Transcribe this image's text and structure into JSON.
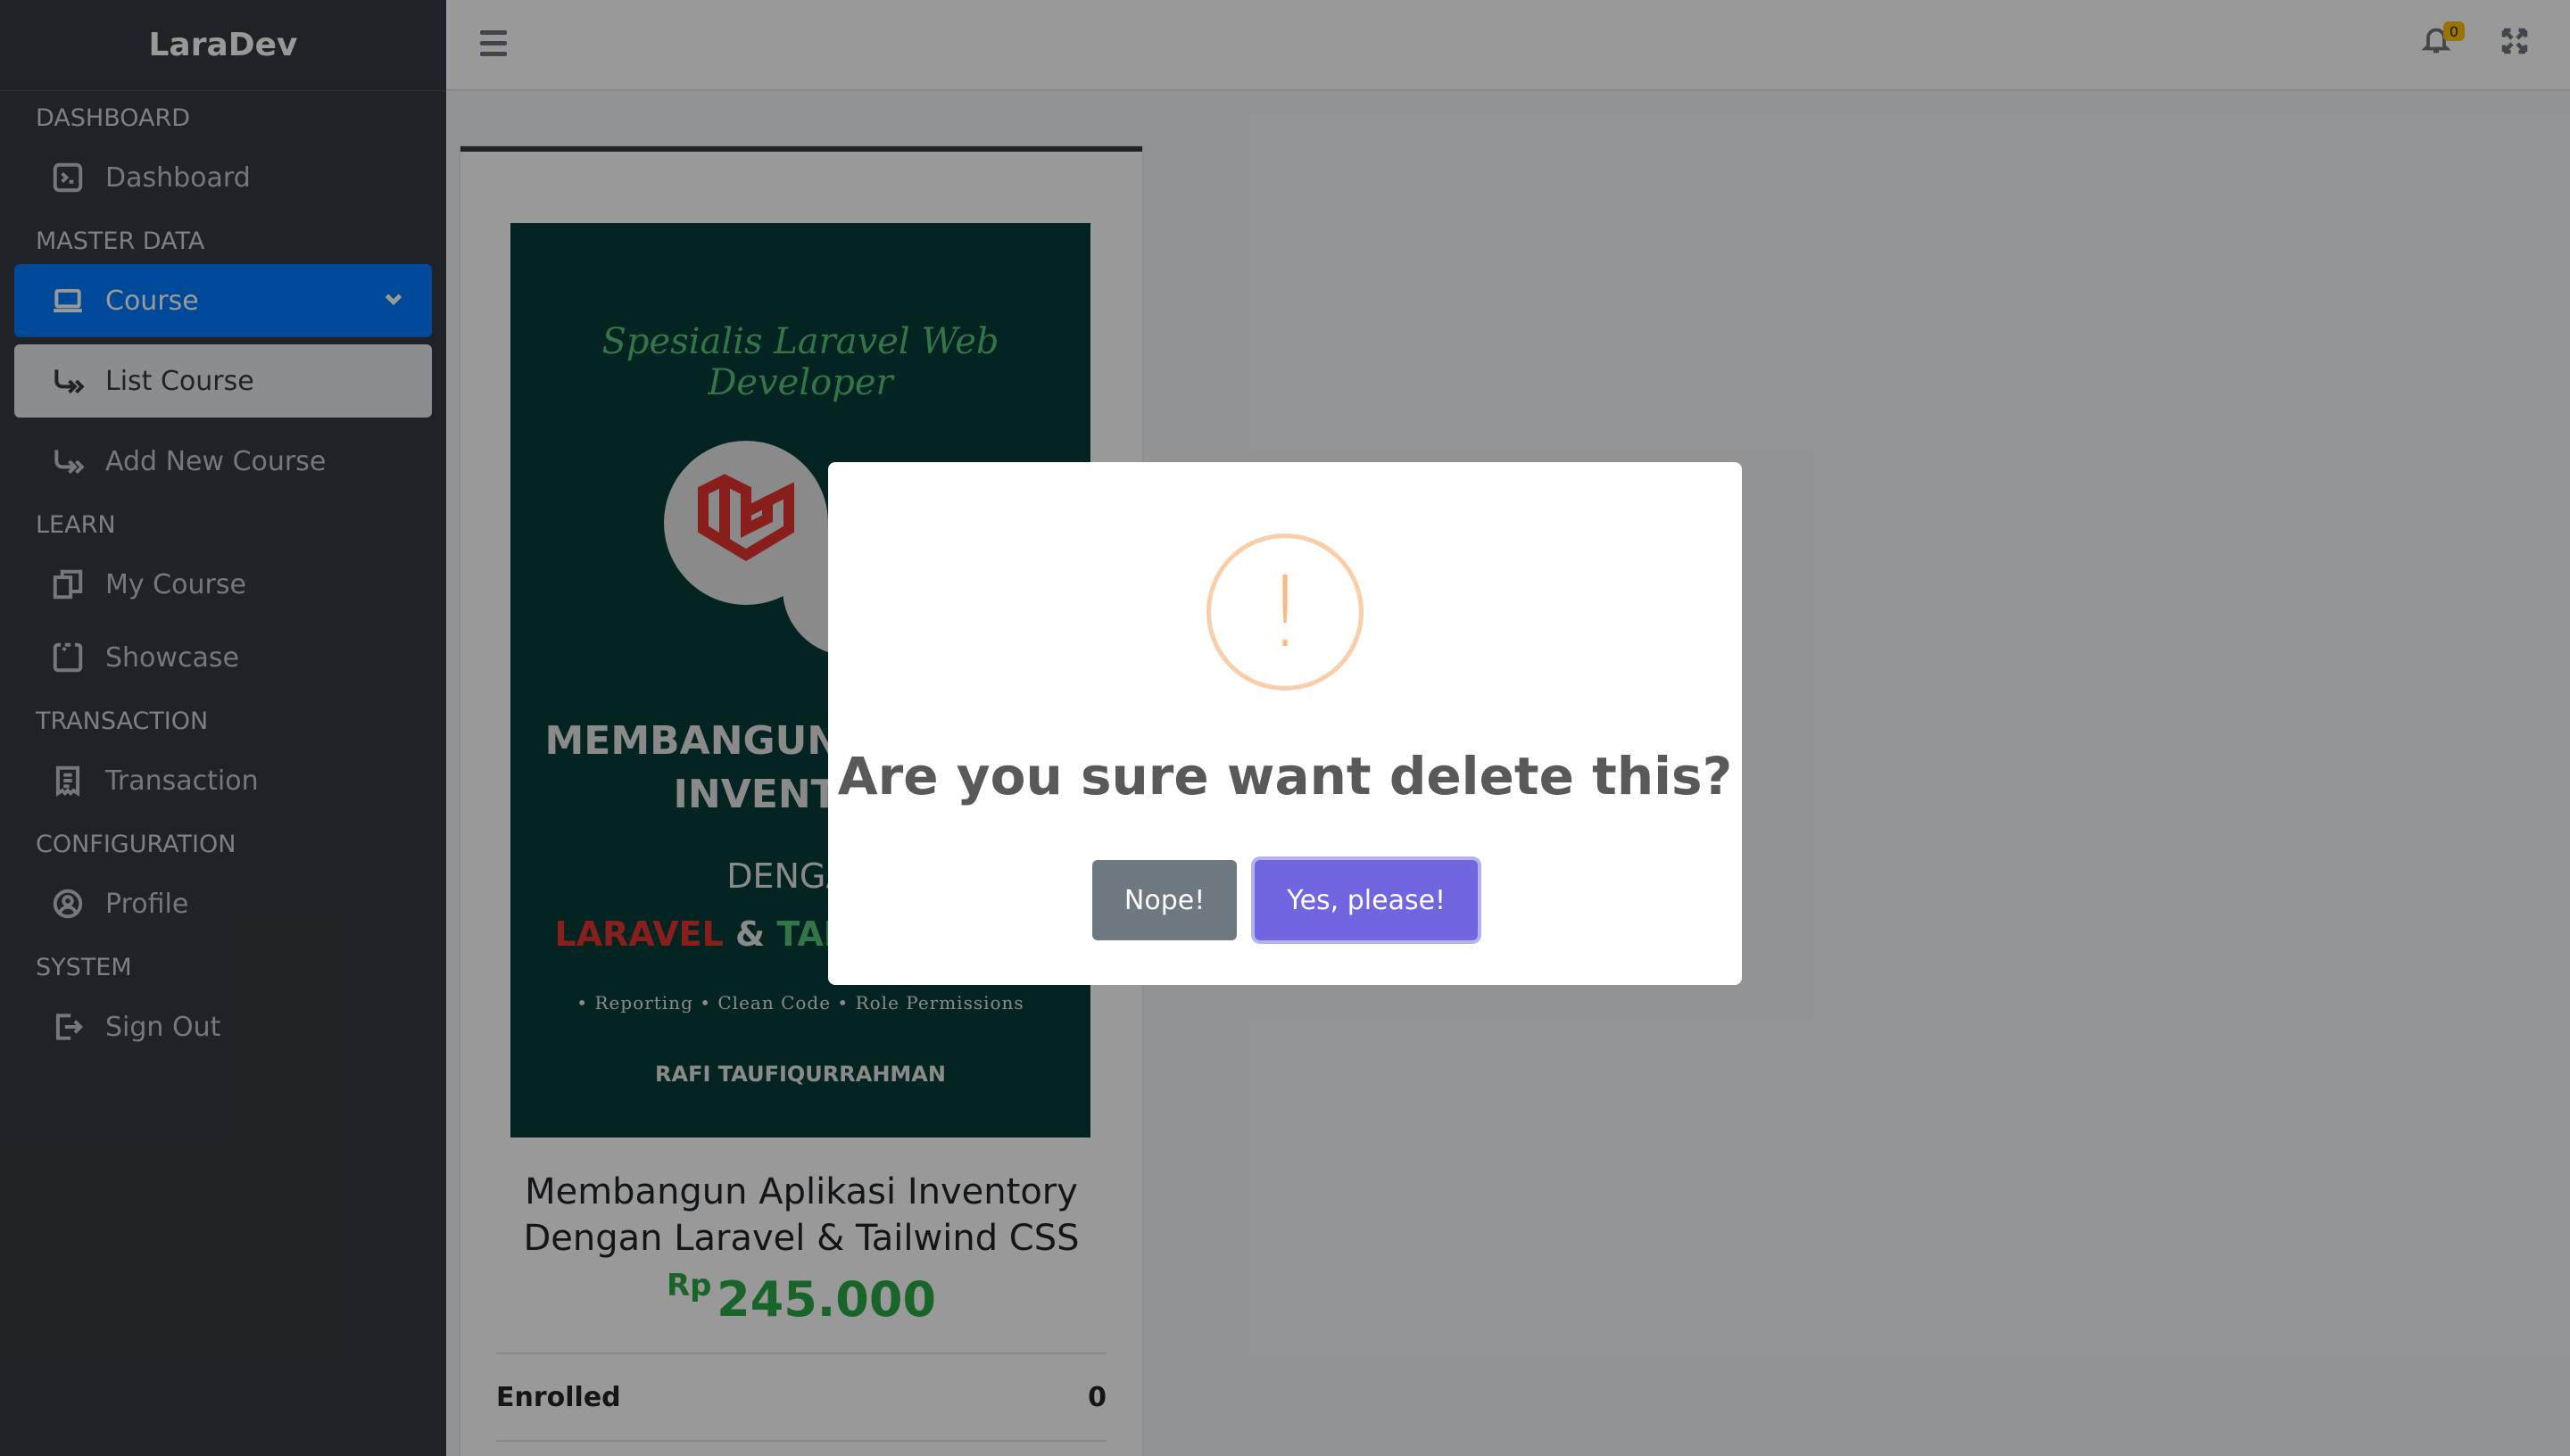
{
  "app": {
    "brand": "LaraDev"
  },
  "sidebar": {
    "sections": [
      {
        "header": "DASHBOARD",
        "items": [
          {
            "label": "Dashboard",
            "icon": "terminal-icon"
          }
        ]
      },
      {
        "header": "MASTER DATA",
        "items": [
          {
            "label": "Course",
            "icon": "laptop-icon",
            "state": "active"
          },
          {
            "label": "List Course",
            "icon": "subitem-arrow-icon",
            "state": "sub-active"
          },
          {
            "label": "Add New Course",
            "icon": "subitem-arrow-icon"
          }
        ]
      },
      {
        "header": "LEARN",
        "items": [
          {
            "label": "My Course",
            "icon": "copy-icon"
          },
          {
            "label": "Showcase",
            "icon": "bubble-icon"
          }
        ]
      },
      {
        "header": "TRANSACTION",
        "items": [
          {
            "label": "Transaction",
            "icon": "receipt-icon"
          }
        ]
      },
      {
        "header": "CONFIGURATION",
        "items": [
          {
            "label": "Profile",
            "icon": "user-circle-icon"
          }
        ]
      },
      {
        "header": "SYSTEM",
        "items": [
          {
            "label": "Sign Out",
            "icon": "sign-out-icon"
          }
        ]
      }
    ]
  },
  "topbar": {
    "notifications_count": "0"
  },
  "course_card": {
    "cover": {
      "tagline": "Spesialis Laravel Web Developer",
      "title_line1": "MEMBANGUN APLIKASI",
      "title_line2": "INVENTORY",
      "with": "DENGAN",
      "stack_red": "LARAVEL",
      "stack_amp": "&",
      "stack_green": "TAILWIND CSS",
      "features": "• Reporting • Clean Code • Role Permissions",
      "author": "RAFI TAUFIQURRAHMAN"
    },
    "title": "Membangun Aplikasi Inventory Dengan Laravel & Tailwind CSS",
    "price_currency": "Rp",
    "price_amount": "245.000",
    "enrolled_label": "Enrolled",
    "enrolled_value": "0"
  },
  "modal": {
    "icon_glyph": "!",
    "title": "Are you sure want delete this?",
    "cancel_label": "Nope!",
    "confirm_label": "Yes, please!"
  },
  "colors": {
    "primary": "#007bff",
    "sidebar": "#343a40",
    "confirm": "#7066e0",
    "cancel": "#6e7881",
    "price": "#28a745",
    "warning": "#f8bb86"
  }
}
